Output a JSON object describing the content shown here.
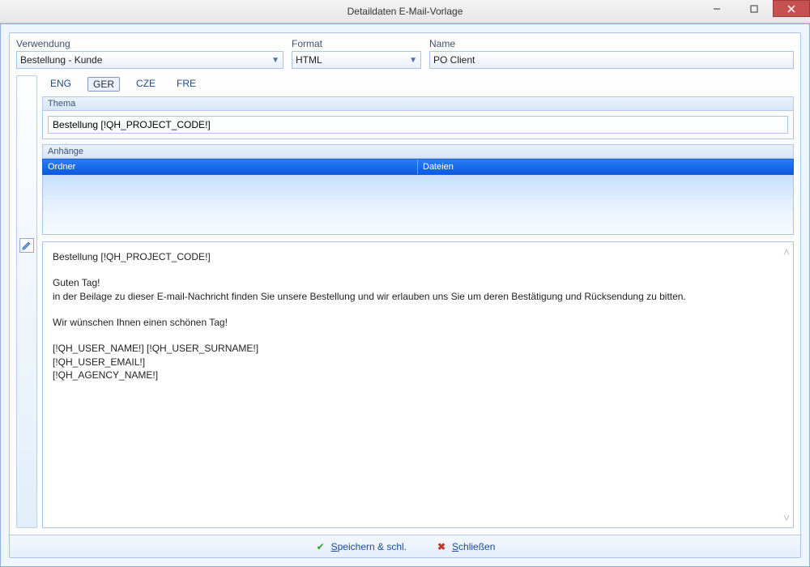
{
  "window": {
    "title": "Detaildaten E-Mail-Vorlage"
  },
  "fields": {
    "usage": {
      "label": "Verwendung",
      "value": "Bestellung - Kunde"
    },
    "format": {
      "label": "Format",
      "value": "HTML"
    },
    "name": {
      "label": "Name",
      "value": "PO Client"
    }
  },
  "lang_tabs": [
    "ENG",
    "GER",
    "CZE",
    "FRE"
  ],
  "lang_active": "GER",
  "sections": {
    "theme_label": "Thema",
    "theme_value": "Bestellung [!QH_PROJECT_CODE!]",
    "attach_label": "Anhänge",
    "attach_cols": {
      "folder": "Ordner",
      "files": "Dateien"
    }
  },
  "body_text": "Bestellung [!QH_PROJECT_CODE!]\n\nGuten Tag!\nin der Beilage zu dieser E-mail-Nachricht finden Sie unsere Bestellung und wir erlauben uns Sie um deren Bestätigung und Rücksendung zu bitten.\n\nWir wünschen Ihnen einen schönen Tag!\n\n[!QH_USER_NAME!] [!QH_USER_SURNAME!]\n[!QH_USER_EMAIL!]\n[!QH_AGENCY_NAME!]",
  "buttons": {
    "save": {
      "prefix": "S",
      "rest": "peichern & schl."
    },
    "close": {
      "prefix": "S",
      "rest": "chließen"
    }
  }
}
